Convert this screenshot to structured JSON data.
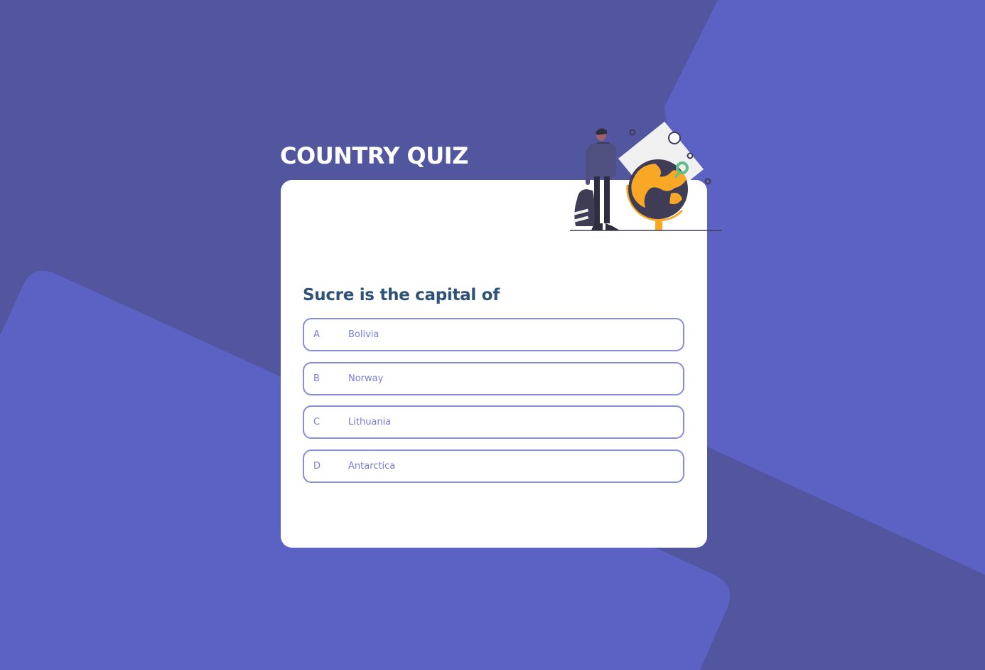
{
  "quiz": {
    "title": "COUNTRY QUIZ",
    "question": "Sucre is the capital of",
    "options": [
      {
        "letter": "A",
        "text": "Bolivia"
      },
      {
        "letter": "B",
        "text": "Norway"
      },
      {
        "letter": "C",
        "text": "Lithuania"
      },
      {
        "letter": "D",
        "text": "Antarctica"
      }
    ]
  },
  "colors": {
    "background": "#52569f",
    "background_shape": "#5c62c3",
    "card": "#ffffff",
    "question_text": "#2f527b",
    "option_accent": "#6066d0",
    "globe_accent": "#f9a826",
    "pin": "#60bf88"
  },
  "illustration": {
    "icon": "traveler-with-globe-illustration"
  }
}
